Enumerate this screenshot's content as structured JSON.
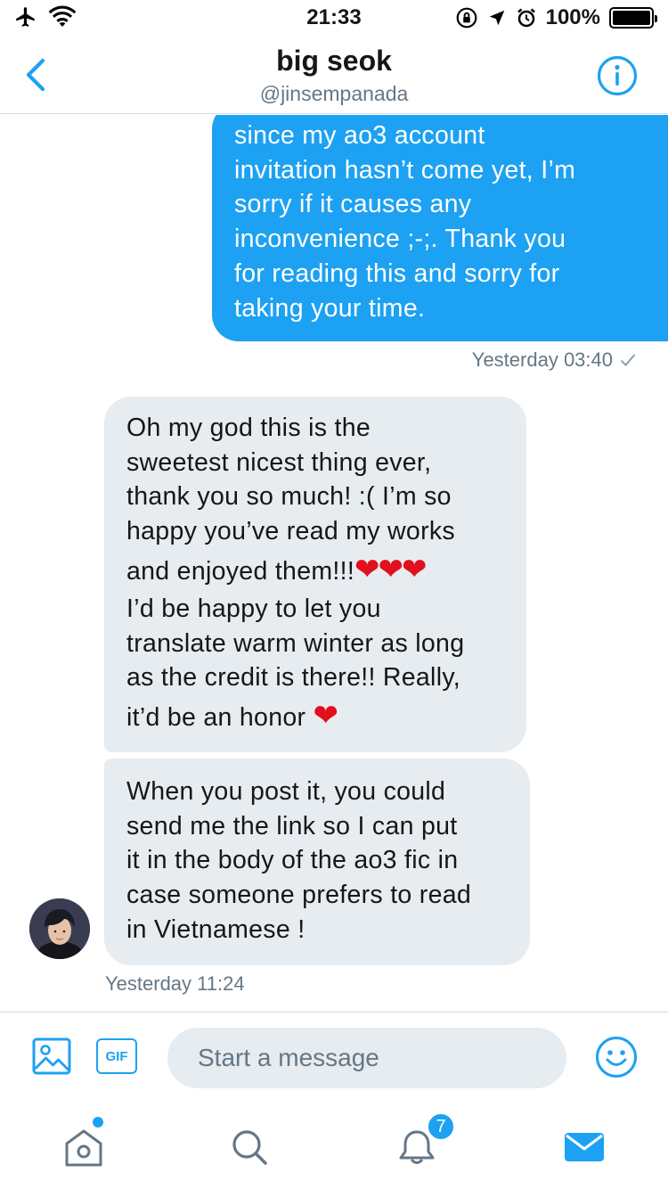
{
  "status_bar": {
    "time": "21:33",
    "battery": "100%",
    "icons": [
      "airplane-icon",
      "wifi-icon",
      "orientation-lock-icon",
      "location-icon",
      "alarm-icon",
      "battery-icon"
    ]
  },
  "header": {
    "name": "big seok",
    "handle": "@jinsempanada",
    "back_icon": "chevron-left-icon",
    "info_icon": "info-icon"
  },
  "messages": {
    "outgoing": {
      "text": "since my ao3 account\ninvitation hasn’t come yet, I’m\nsorry if it causes any\ninconvenience ;-;. Thank you\nfor reading this and sorry for\ntaking your time.",
      "timestamp": "Yesterday 03:40",
      "status_icon": "check-icon"
    },
    "incoming_1": {
      "line_1": "Oh my god this is the",
      "line_2": "sweetest nicest thing ever,",
      "line_3": "thank you so much! :( I’m so",
      "line_4": "happy you’ve read my works",
      "line_5": "and enjoyed them!!!",
      "hearts_5": "❤❤❤",
      "line_6": "I’d be happy to let you",
      "line_7": "translate warm winter as long",
      "line_8": "as the credit is there!! Really,",
      "line_9": "it’d be an honor ",
      "hearts_9": "❤"
    },
    "incoming_2": {
      "text": "When you post it, you could\nsend me the link so I can put\nit in the body of the ao3 fic in\ncase someone prefers to read\nin Vietnamese !",
      "timestamp": "Yesterday 11:24"
    }
  },
  "composer": {
    "placeholder": "Start a message",
    "gif_label": "GIF"
  },
  "tab_bar": {
    "notifications_badge": "7"
  },
  "colors": {
    "accent": "#1da1f2",
    "incoming_bubble": "#e6ecf0",
    "secondary_text": "#657786",
    "heart": "#e0101c"
  }
}
